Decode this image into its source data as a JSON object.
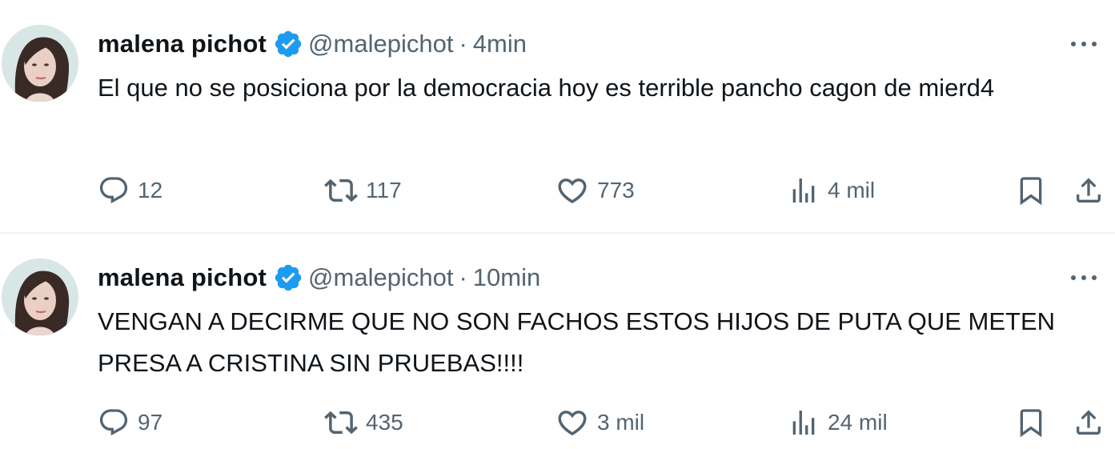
{
  "tweets": [
    {
      "name": "malena pichot",
      "handle": "@malepichot",
      "separator": "·",
      "time": "4min",
      "text": "El que no se posiciona por la democracia hoy es terrible pancho cagon de mierd4",
      "replies": "12",
      "retweets": "117",
      "likes": "773",
      "views": "4 mil"
    },
    {
      "name": "malena pichot",
      "handle": "@malepichot",
      "separator": "·",
      "time": "10min",
      "text": "VENGAN A DECIRME QUE NO SON FACHOS ESTOS HIJOS DE PUTA QUE METEN PRESA A CRISTINA SIN PRUEBAS!!!!",
      "replies": "97",
      "retweets": "435",
      "likes": "3 mil",
      "views": "24 mil"
    }
  ],
  "colors": {
    "verified": "#1d9bf0",
    "text": "#0f1419",
    "secondary": "#536471",
    "divider": "#eff3f4"
  },
  "icons": [
    "avatar",
    "verified-badge-icon",
    "more-options-icon",
    "reply-icon",
    "retweet-icon",
    "like-icon",
    "views-icon",
    "bookmark-icon",
    "share-icon"
  ]
}
